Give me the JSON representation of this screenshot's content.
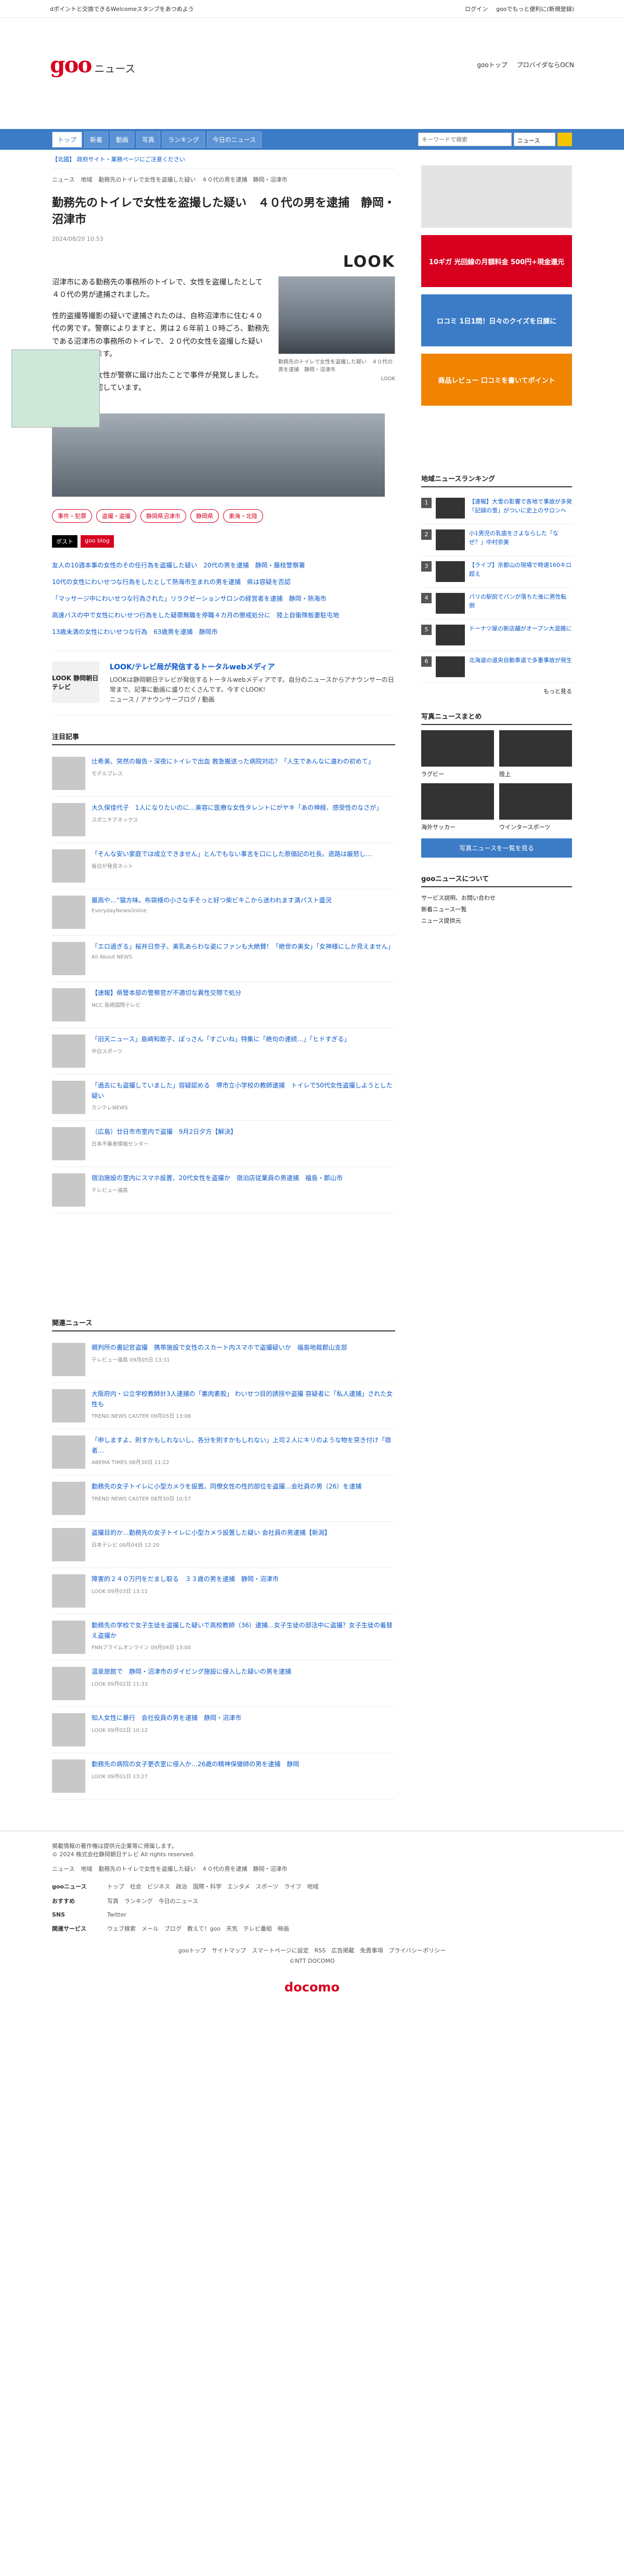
{
  "topbar": {
    "promo": "dポイントと交換できるWelcomeスタンプをあつめよう",
    "login": "ログイン",
    "tool": "gooでもっと便利に(新規登録)"
  },
  "header": {
    "logo": "goo",
    "news": "ニュース",
    "links": [
      "gooトップ",
      "プロバイダならOCN"
    ]
  },
  "nav": {
    "tabs": [
      "トップ",
      "新着",
      "動画",
      "写真",
      "ランキング",
      "今日のニュース"
    ],
    "search_placeholder": "キーワードで検索",
    "search_select": "ニュース"
  },
  "article": {
    "notice": "【北國】 政府サイト・業務ページにご注意ください",
    "breadcrumb": [
      "ニュース",
      "地域",
      "勤務先のトイレで女性を盗撮した疑い　４０代の男を逮捕　静岡・沼津市"
    ],
    "title": "勤務先のトイレで女性を盗撮した疑い　４０代の男を逮捕　静岡・沼津市",
    "date": "2024/08/20 10:53",
    "brand": "LOOK",
    "p1": "沼津市にある勤務先の事務所のトイレで、女性を盗撮したとして４０代の男が逮捕されました。",
    "p2": "性的盗撮等撮影の疑いで逮捕されたのは、自称沼津市に住む４０代の男です。警察によりますと、男は２６年前１０時ごろ、勤務先である沼津市の事務所のトイレで、２０代の女性を盗撮した疑いがもたれています。",
    "p3": "被害にあった女性が警察に届け出たことで事件が発覚しました。男は容疑を否認しています。",
    "caption": "勤務先のトイレで女性を盗撮した疑い　４０代の男を逮捕　静岡・沼津市",
    "caption_brand": "LOOK",
    "tags": [
      "事件・犯罪",
      "盗撮・盗撮",
      "静岡県沼津市",
      "静岡県",
      "東海・北陸"
    ],
    "share": [
      "ポスト",
      "goo blog"
    ]
  },
  "related": [
    "友人の10週本事の女性のその任行為を盗撮した疑い　20代の男を逮捕　静岡・藤枝警察署",
    "10代の女性にわいせつな行為をしたとして熱海市生まれの男を逮捕　県は容疑を否認",
    "「マッサージ中にわいせつな行為された」リラクゼーションサロンの経営者を逮捕　静岡・熱海市",
    "高速バスの中で女性にわいせつ行為をした疑罪無職を停職４カ月の懲戒処分に　陸上自衛隊板妻駐屯地",
    "13歳未満の女性にわいせつな行為　63歳男を逮捕　静岡市"
  ],
  "promo": {
    "logo": "LOOK 静岡朝日テレビ",
    "title": "LOOK/テレビ局が発信するトータルwebメディア",
    "desc": "LOOKは静岡朝日テレビが発信するトータルwebメディアです。自分のニュースからアナウンサーの日常まで、記事に動画に盛りだくさんです。今すぐLOOK!",
    "links": "ニュース / アナウンサーブログ / 動画"
  },
  "featured": {
    "title": "注目記事",
    "items": [
      {
        "t": "辻希美、突然の報告・深夜にトイレで出血 救急搬送った病院対応？「人生であんなに違わの初めて」",
        "s": "モデルプレス"
      },
      {
        "t": "大久保佳代子　1人になりたいのに…美容に医療な女性タレントにがヤキ「あの神経、感受性のなさが」",
        "s": "スポニチアネックス"
      },
      {
        "t": "「そんな安い家庭では成立できません」とんでもない事言を口にした原価記の社長。退路は厳怒し…",
        "s": "毎日が発見ネット"
      },
      {
        "t": "最高や…”猫方味。布袋様の小さな手そっと好つ柴ビキこから迷われます満パスト盛況",
        "s": "EverydayNewsOnline"
      },
      {
        "t": "「エロ過ぎる」桜井日奈子、美乳あらわな姿にファンも大絶賛！「絶世の美女」「女神様にしか見えません」",
        "s": "All About NEWS"
      },
      {
        "t": "【速報】県警本部の警察官が不適切な異性交際で処分",
        "s": "NCC 長崎国際テレビ"
      },
      {
        "t": "「旧天ニュース」島崎和歌子、ぽっさん「すごいね」特集に「絶句の連続…」「ヒドすぎる」",
        "s": "中日スポーツ"
      },
      {
        "t": "「過去にも盗撮していました」容疑認める　堺市立小学校の教師逮捕　トイレで50代女性盗撮しようとした疑い",
        "s": "カンテレNEWS"
      },
      {
        "t": "（広島）廿日市市室内で盗撮　9月2日夕方【解決】",
        "s": "日本不審者情報センター"
      },
      {
        "t": "宿泊施設の室内にスマホ設置、20代女性を盗撮か　宿泊店従業員の男逮捕　福島・郡山市",
        "s": "テレビュー福島"
      }
    ]
  },
  "news_related": {
    "title": "関連ニュース",
    "items": [
      {
        "t": "親判所の書記官盗撮　携帯施設で女性のスカート内スマホで盗撮疑いか　福島地裁郡山支部",
        "s": "テレビュー福島 09月05日 13:31"
      },
      {
        "t": "大阪府内・公立学校教師計3人逮捕の「裏肉素般」 わいせつ目的誘拐や盗撮 容疑者に「私人逮捕」された女性も",
        "s": "TREND NEWS CASTER 09月05日 13:06"
      },
      {
        "t": "「申しますよ、則すかもしれないし、各分を則すかもしれない」上司２人にキリのような物を突き付け「宿者…",
        "s": "ABEMA TIMES 08月30日 11:22"
      },
      {
        "t": "勤務先の女子トイレに小型カメラを設置。同僚女性の性的部位を盗撮…会社員の男（26）を逮捕",
        "s": "TREND NEWS CASTER 08月30日 10:57"
      },
      {
        "t": "盗撮目的か…勤務先の女子トイレに小型カメラ設置した疑い 会社員の男逮捕【新潟】",
        "s": "日本テレビ 09月04日 12:20"
      },
      {
        "t": "障害的２４０万円をだまし取る　３３歳の男を逮捕　静岡・沼津市",
        "s": "LOOK 09月03日 13:11"
      },
      {
        "t": "勤務先の学校で女子生徒を盗撮した疑いで高校教師（36）逮捕…女子生徒の部活中に盗撮？女子生徒の着替え盗撮か",
        "s": "FNNプライムオンライン 09月04日 13:00"
      },
      {
        "t": "温泉旅館で　静岡・沼津市のダイビング施設に侵入した疑いの男を逮捕",
        "s": "LOOK 09月02日 11:33"
      },
      {
        "t": "知人女性に暴行　会社役員の男を逮捕　静岡・沼津市",
        "s": "LOOK 09月02日 10:12"
      },
      {
        "t": "勤務先の病院の女子更衣室に侵入か…26歳の精神保健師の男を逮捕　静岡",
        "s": "LOOK 09月01日 13:27"
      }
    ]
  },
  "sidebar": {
    "banner1": "10ギガ 光回線の月額料金 500円+現金還元",
    "banner2": "ロコミ 1日1問！日々のクイズを日課に",
    "banner3": "商品レビュー 口コミを書いてポイント",
    "ranking_title": "地域ニュースランキング",
    "ranking": [
      "【速報】大雪の影響で各地で事故が多発「記録の雪」がついに史上のサロンへ",
      "小1男児の乳歯をさよならした「なぜ？」中村奈美",
      "【ライブ】京都山の現場で時速160キロ超え",
      "パリの駅前でパンが落ちた後に男性転倒",
      "ドーナツ屋の新店舗がオープン大混雑に",
      "北海道の道央自動車道で多重事故が発生"
    ],
    "more": "もっと見る",
    "photo_title": "写真ニュースまとめ",
    "photos": [
      "ラグビー",
      "陸上",
      "海外サッカー",
      "ウインタースポーツ"
    ],
    "photo_btn": "写真ニュースを一覧を見る",
    "about_title": "gooニュースについて",
    "about_links": [
      "サービス説明、お問い合わせ",
      "新着ニュース一覧",
      "ニュース提供元"
    ]
  },
  "footer": {
    "copyright": "掲載情報の著作権は提供元企業等に帰属します。",
    "copy2": "© 2024 株式会社静岡朝日テレビ All rights reserved.",
    "crumb": [
      "ニュース",
      "地域",
      "勤務先のトイレで女性を盗撮した疑い　４０代の男を逮捕　静岡・沼津市"
    ],
    "rows": [
      {
        "h": "gooニュース",
        "v": "トップ　社会　ビジネス　政治　国際・科学　エンタメ　スポーツ　ライフ　地域"
      },
      {
        "h": "おすすめ",
        "v": "写真　ランキング　今日のニュース"
      },
      {
        "h": "SNS",
        "v": "Twitter"
      },
      {
        "h": "関連サービス",
        "v": "ウェブ検索　メール　ブログ　教えて！goo　天気　テレビ番組　映画"
      }
    ],
    "bottom": "gooトップ　サイトマップ　スマートページに設定　RSS　広告掲載　免責事項　プライバシーポリシー",
    "ntt": "©NTT DOCOMO",
    "docomo": "docomo"
  }
}
